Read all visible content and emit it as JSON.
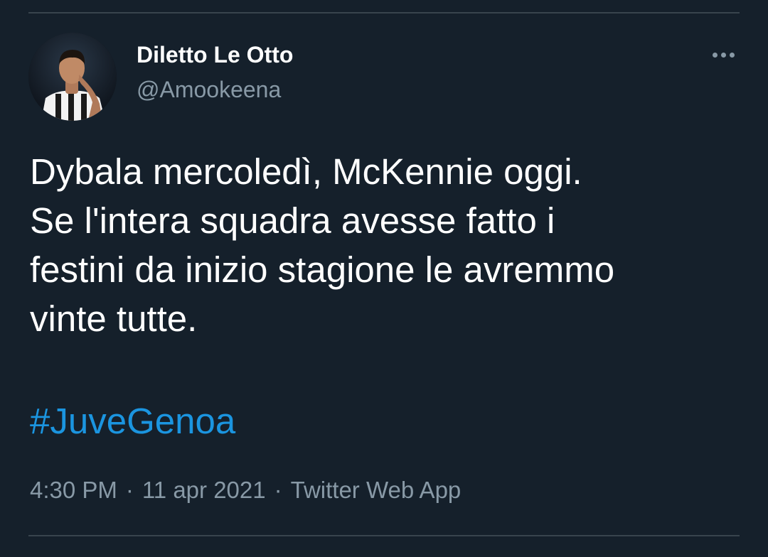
{
  "tweet": {
    "author": {
      "display_name": "Diletto Le Otto",
      "handle": "@Amookeena",
      "avatar_icon": "profile-photo"
    },
    "more_icon": "more-horizontal-icon",
    "text": "Dybala mercoledì, McKennie oggi.\nSe l'intera squadra avesse fatto i\nfestini da inizio stagione le avremmo\nvinte tutte.",
    "hashtag": "#JuveGenoa",
    "time": "4:30 PM",
    "separator": "·",
    "date": "11 apr 2021",
    "source": "Twitter Web App"
  },
  "colors": {
    "background": "#15202b",
    "primary_text": "#ffffff",
    "secondary_text": "#8899a6",
    "link": "#1b95e0",
    "divider": "#38444d"
  }
}
